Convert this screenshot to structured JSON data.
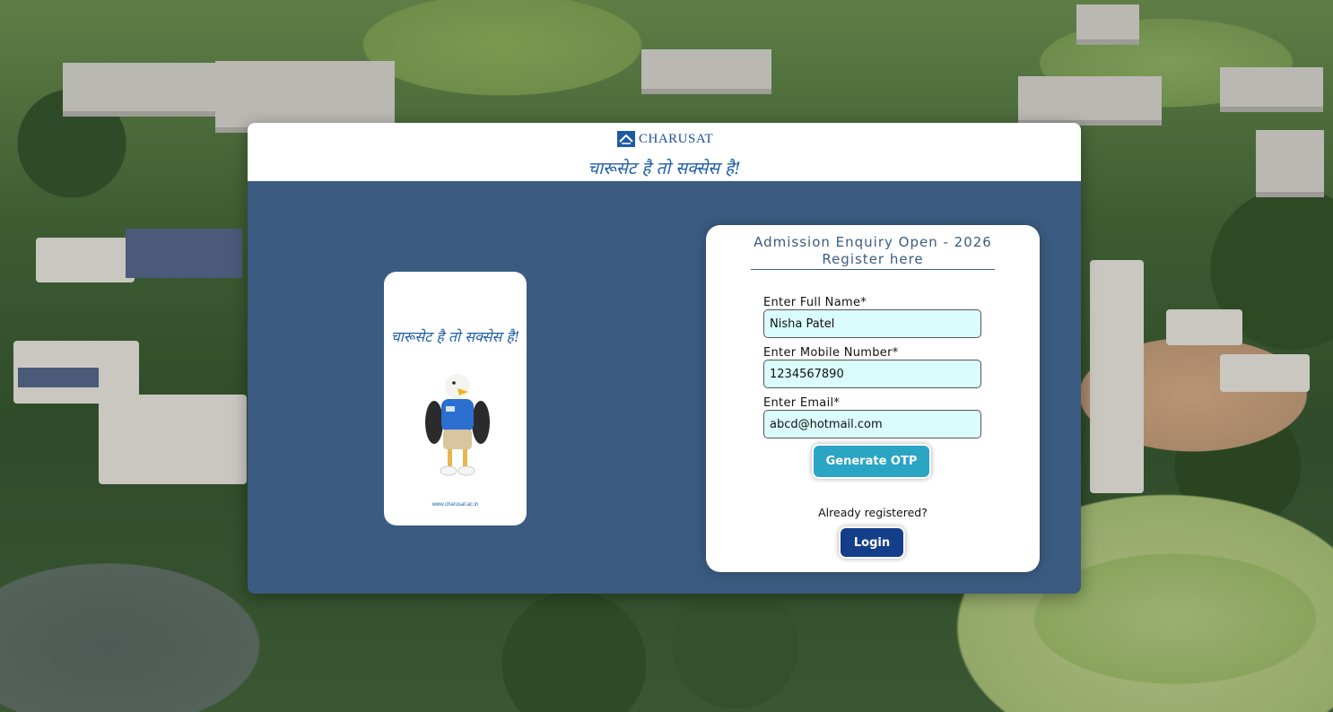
{
  "brand": {
    "logo_text": "CHARUSAT",
    "slogan": "चारूसेट है तो सक्सेस है!"
  },
  "mascot_card": {
    "slogan": "चारूसेट है तो सक्सेस है!",
    "url": "www.charusat.ac.in"
  },
  "form": {
    "title_line1": "Admission Enquiry Open - 2026",
    "title_line2": "Register here",
    "fields": [
      {
        "label": "Enter Full Name*",
        "value": "Nisha Patel"
      },
      {
        "label": "Enter Mobile Number*",
        "value": "1234567890"
      },
      {
        "label": "Enter Email*",
        "value": "abcd@hotmail.com"
      }
    ],
    "generate_otp_label": "Generate OTP",
    "already_registered": "Already registered?",
    "login_label": "Login"
  },
  "colors": {
    "panel_blue": "#3b5b80",
    "otp_button": "#2aa5c4",
    "login_button": "#153e8a",
    "input_bg": "#dafcfc",
    "brand_blue": "#1f5fa8"
  },
  "icons": {
    "logo": "charusat-logo-icon",
    "mascot": "eagle-mascot-icon"
  }
}
